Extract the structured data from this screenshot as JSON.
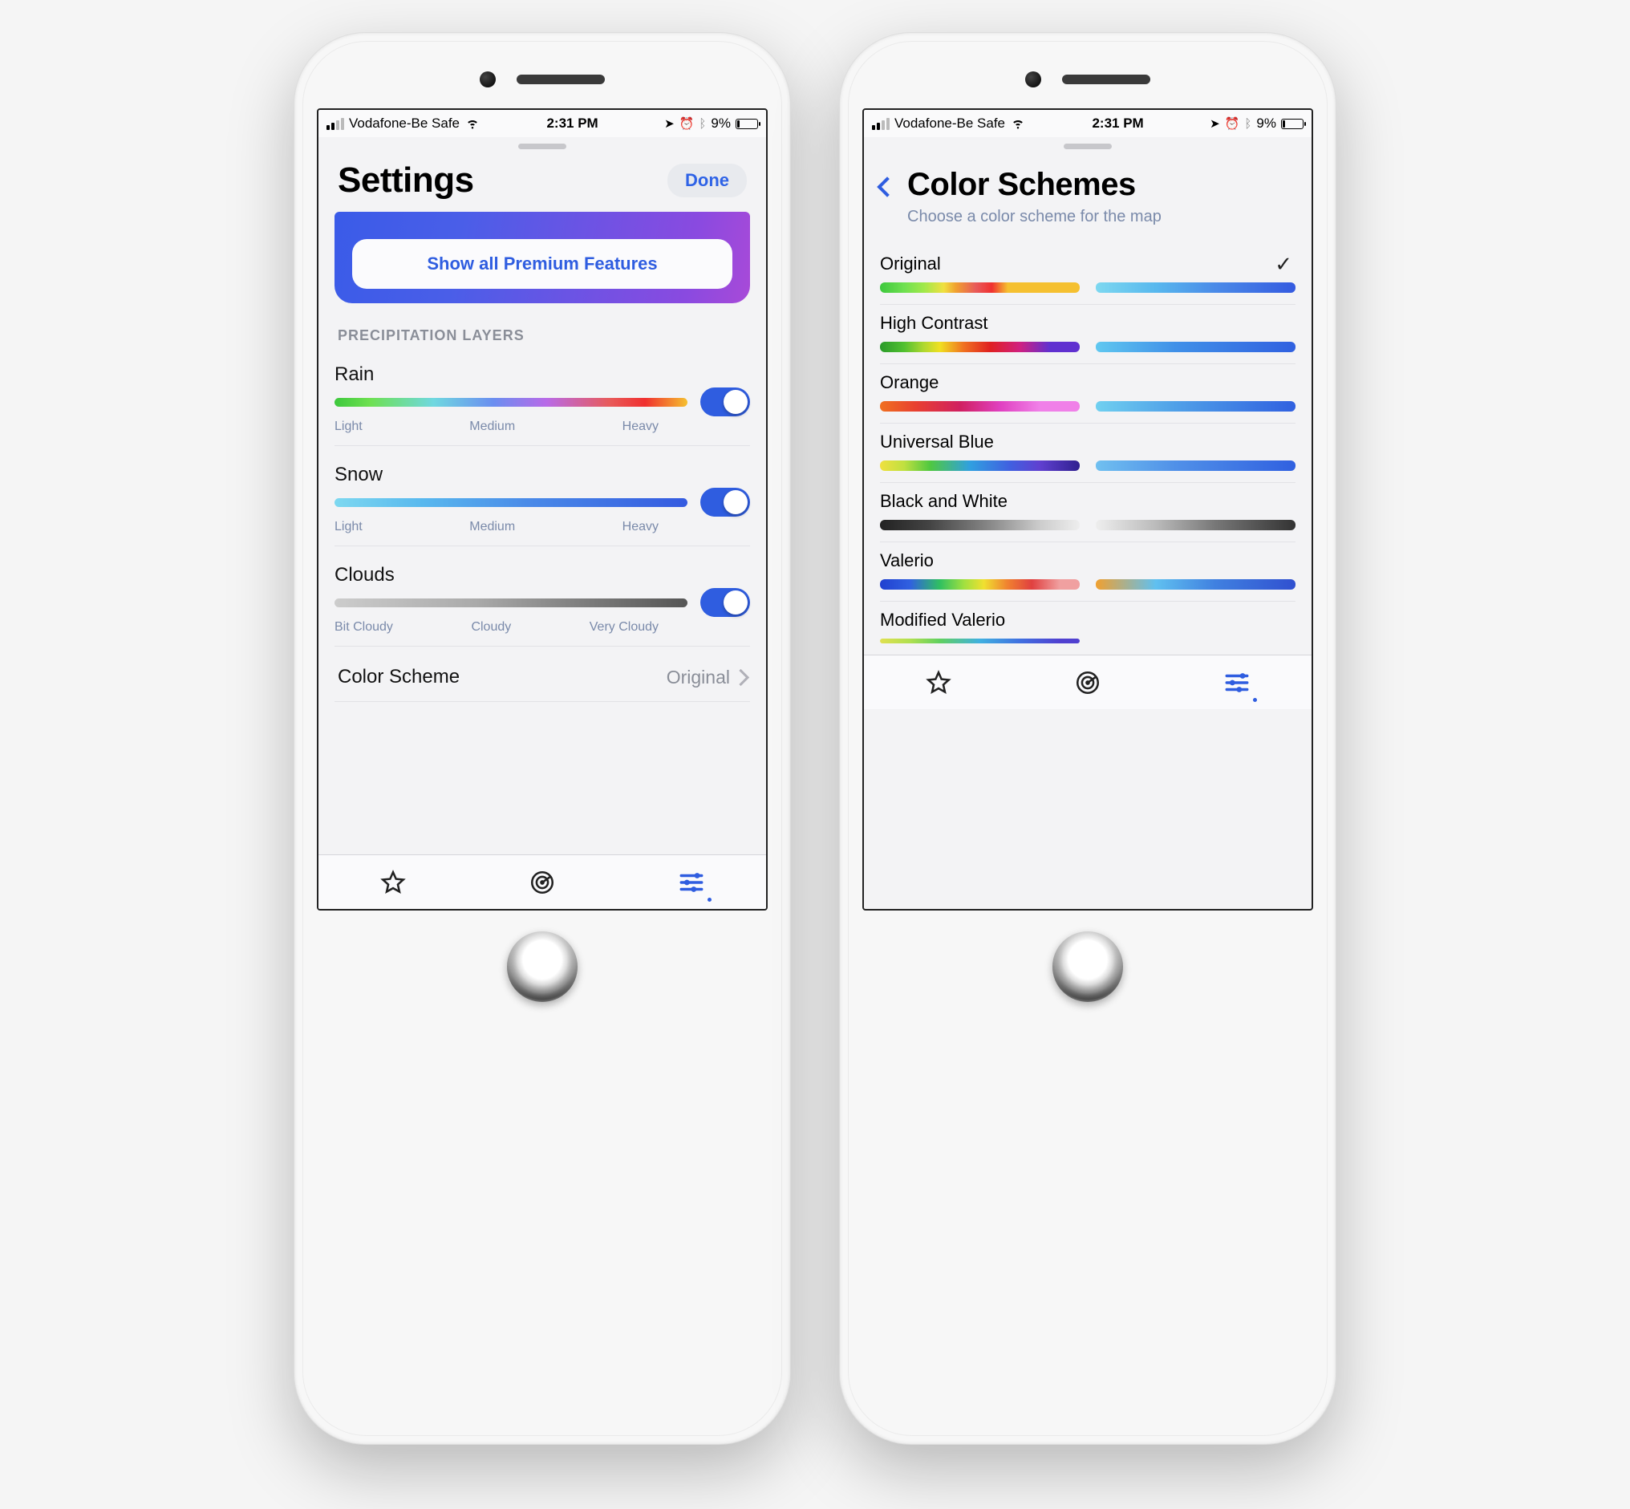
{
  "statusbar": {
    "carrier": "Vodafone-Be Safe",
    "time": "2:31 PM",
    "battery": "9%"
  },
  "screen1": {
    "title": "Settings",
    "done": "Done",
    "premium_cta": "Show all Premium Features",
    "section_title": "PRECIPITATION LAYERS",
    "rain": {
      "label": "Rain",
      "l1": "Light",
      "l2": "Medium",
      "l3": "Heavy"
    },
    "snow": {
      "label": "Snow",
      "l1": "Light",
      "l2": "Medium",
      "l3": "Heavy"
    },
    "clouds": {
      "label": "Clouds",
      "l1": "Bit Cloudy",
      "l2": "Cloudy",
      "l3": "Very Cloudy"
    },
    "color_scheme_label": "Color Scheme",
    "color_scheme_value": "Original"
  },
  "screen2": {
    "title": "Color Schemes",
    "subtitle": "Choose a color scheme for the map",
    "schemes": {
      "original": "Original",
      "high_contrast": "High Contrast",
      "orange": "Orange",
      "universal_blue": "Universal Blue",
      "black_white": "Black and White",
      "valerio": "Valerio",
      "mod_valerio": "Modified Valerio"
    },
    "selected": "original"
  }
}
